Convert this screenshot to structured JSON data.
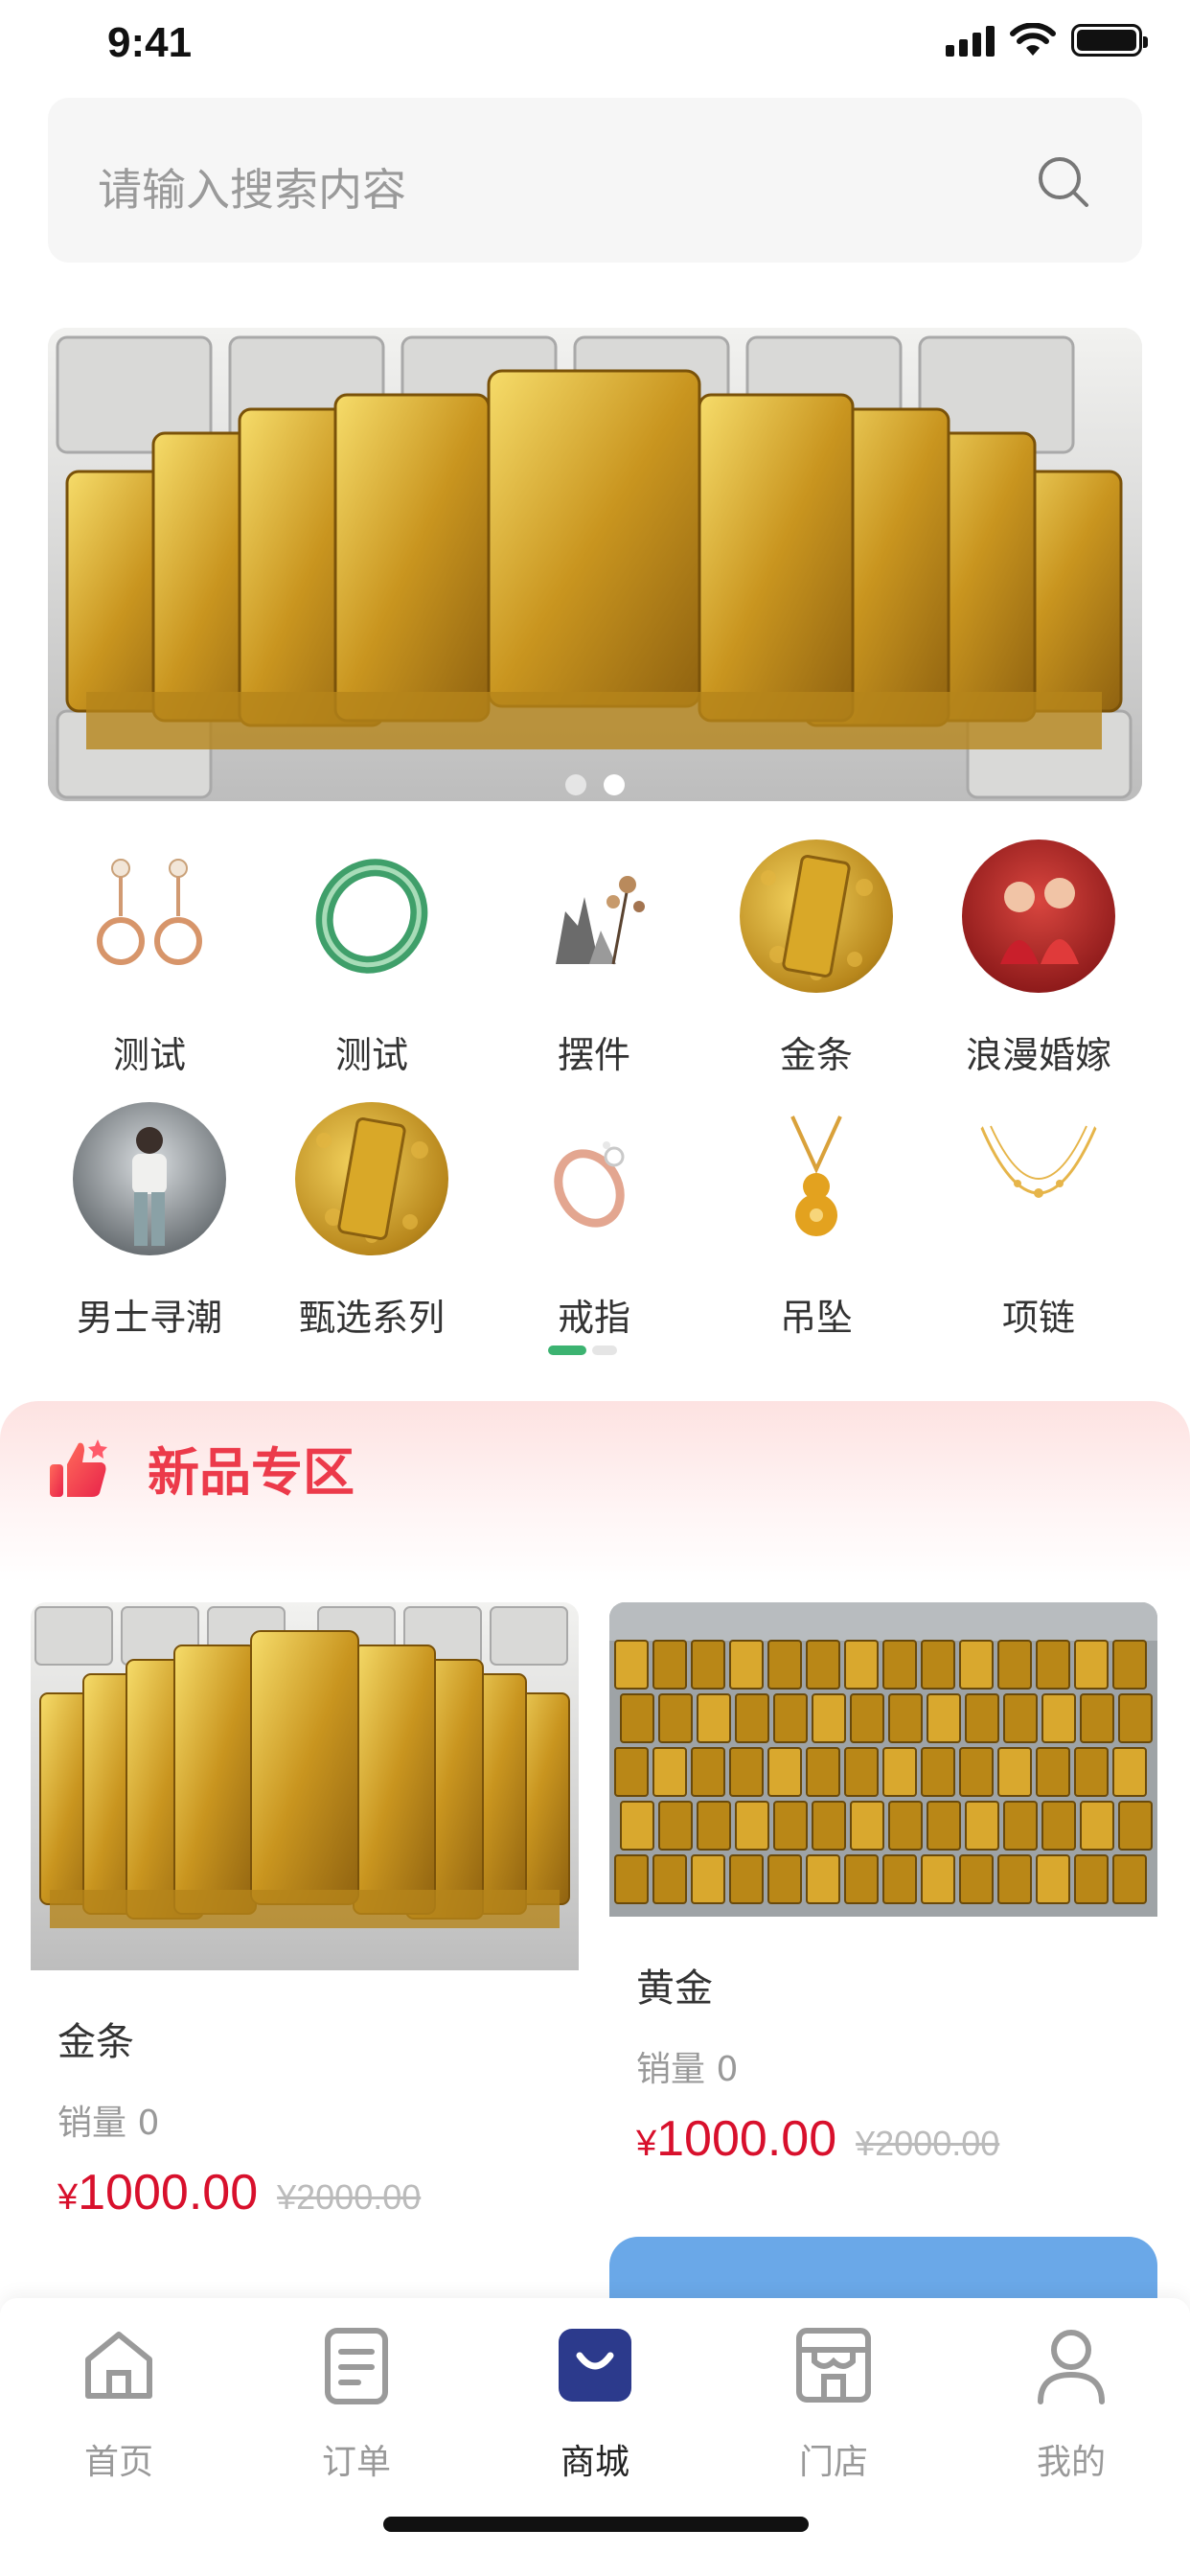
{
  "status": {
    "time": "9:41"
  },
  "search": {
    "placeholder": "请输入搜索内容"
  },
  "banner": {
    "dots": 2,
    "active_dot": 1
  },
  "categories": [
    {
      "label": "测试",
      "icon": "earrings-icon"
    },
    {
      "label": "测试",
      "icon": "jade-bangle-icon"
    },
    {
      "label": "摆件",
      "icon": "ornament-icon"
    },
    {
      "label": "金条",
      "icon": "gold-bar-icon"
    },
    {
      "label": "浪漫婚嫁",
      "icon": "wedding-icon"
    },
    {
      "label": "男士寻潮",
      "icon": "mens-fashion-icon"
    },
    {
      "label": "甄选系列",
      "icon": "gold-bar-icon"
    },
    {
      "label": "戒指",
      "icon": "ring-icon"
    },
    {
      "label": "吊坠",
      "icon": "pendant-icon"
    },
    {
      "label": "项链",
      "icon": "necklace-icon"
    }
  ],
  "new_section": {
    "title": "新品专区",
    "icon": "thumbs-up-icon"
  },
  "products": [
    {
      "name": "金条",
      "sales": "销量 0",
      "currency": "¥",
      "price": "1000.00",
      "original_price": "¥2000.00"
    },
    {
      "name": "黄金",
      "sales": "销量 0",
      "currency": "¥",
      "price": "1000.00",
      "original_price": "¥2000.00"
    }
  ],
  "tabs": [
    {
      "label": "首页",
      "icon": "home-icon",
      "active": false
    },
    {
      "label": "订单",
      "icon": "order-icon",
      "active": false
    },
    {
      "label": "商城",
      "icon": "shop-bag-icon",
      "active": true
    },
    {
      "label": "门店",
      "icon": "store-icon",
      "active": false
    },
    {
      "label": "我的",
      "icon": "user-icon",
      "active": false
    }
  ],
  "colors": {
    "accent_red": "#ec3a4a",
    "price_red": "#d8102c",
    "tab_active": "#2c3a8c",
    "indicator_green": "#3cb371"
  }
}
